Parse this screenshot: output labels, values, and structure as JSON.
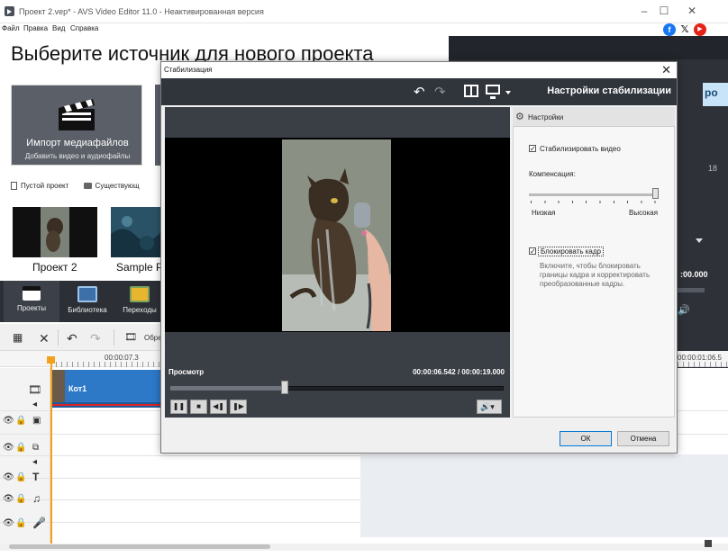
{
  "window": {
    "title": "Проект 2.vep* - AVS Video Editor 11.0 - Неактивированная версия",
    "minimize": "–",
    "maximize": "☐",
    "close": "✕"
  },
  "menu": [
    "Файл",
    "Правка",
    "Вид",
    "Справка"
  ],
  "social": [
    {
      "name": "facebook",
      "glyph": "f",
      "color": "#1877f2"
    },
    {
      "name": "x",
      "glyph": "𝕏",
      "color": "#111111"
    },
    {
      "name": "youtube",
      "glyph": "▶",
      "color": "#e62117"
    }
  ],
  "start": {
    "heading": "Выберите источник для нового проекта",
    "import_title": "Импорт медиафайлов",
    "import_subtitle": "Добавить видео и аудиофайлы",
    "empty_project": "Пустой проект",
    "existing_project": "Существующ",
    "projects": [
      "Проект 2",
      "Sample P"
    ]
  },
  "nav": [
    "Проекты",
    "Библиотека",
    "Переходы"
  ],
  "toolbar": {
    "trim": "Обре"
  },
  "timeline": {
    "time_1": "00:00:07.3",
    "time_2": "00:00:01:06.5",
    "clip_name": "Кот1"
  },
  "right_panel": {
    "peek_text": "ро",
    "peek_number": "18",
    "peek_time": ":00.000"
  },
  "dialog": {
    "title": "Стабилизация",
    "close": "✕",
    "header_title": "Настройки стабилизации",
    "undo": "↶",
    "redo": "↷",
    "preview_label": "Просмотр",
    "current_time": "00:00:06.542",
    "time_separator": "/",
    "total_time": "00:00:19.000",
    "playback_progress": 0.344,
    "controls": {
      "pause": "❚❚",
      "stop": "■",
      "prev": "◀❚",
      "next": "❚▶",
      "volume": "🔊▾"
    },
    "settings": {
      "header": "Настройки",
      "stabilize_label": "Стабилизировать видео",
      "stabilize_checked": true,
      "compensation_label": "Компенсация:",
      "compensation_value": 1.0,
      "low": "Низкая",
      "high": "Высокая",
      "lock_label": "Блокировать кадр",
      "lock_checked": true,
      "lock_hint": "Включите, чтобы блокировать границы кадра и корректировать преобразованные кадры."
    },
    "ok": "ОК",
    "cancel": "Отмена"
  }
}
